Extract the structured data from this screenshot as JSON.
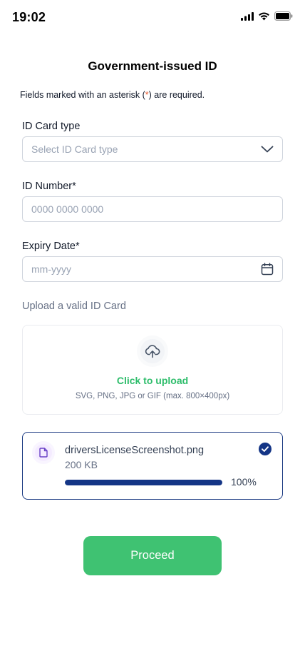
{
  "status_bar": {
    "time": "19:02",
    "icons": [
      "cellular-signal-icon",
      "wifi-icon",
      "battery-icon"
    ]
  },
  "page": {
    "title": "Government-issued ID",
    "required_note_before": "Fields marked with an asterisk (",
    "required_note_asterisk": "*",
    "required_note_after": ") are required."
  },
  "form": {
    "id_card_type": {
      "label": "ID Card type",
      "placeholder": "Select ID Card type",
      "icon": "chevron-down-icon"
    },
    "id_number": {
      "label": "ID Number*",
      "placeholder": "0000 0000 0000"
    },
    "expiry_date": {
      "label": "Expiry Date*",
      "placeholder": "mm-yyyy",
      "icon": "calendar-icon"
    }
  },
  "upload": {
    "label": "Upload a valid ID Card",
    "icon": "cloud-upload-icon",
    "cta": "Click to upload",
    "hint": "SVG, PNG, JPG or GIF (max. 800×400px)"
  },
  "uploaded_file": {
    "icon": "file-icon",
    "name": "driversLicenseScreenshot.png",
    "size": "200 KB",
    "progress_percent": 100,
    "progress_label": "100%",
    "status_icon": "check-circle-icon"
  },
  "actions": {
    "proceed_label": "Proceed"
  },
  "colors": {
    "primary_green": "#3fc272",
    "link_green": "#2ebd6b",
    "navy": "#143586",
    "asterisk": "#e4572e",
    "border": "#d0d5dd"
  }
}
